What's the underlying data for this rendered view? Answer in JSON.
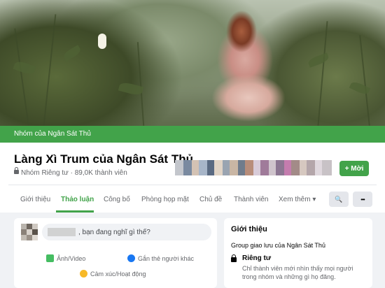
{
  "group_bar_label": "Nhóm của Ngân Sát Thủ",
  "group": {
    "title": "Làng Xì Trum của Ngân Sát Thủ",
    "privacy": "Nhóm Riêng tư",
    "members": "89,0K thành viên",
    "join_label": "+ Mời"
  },
  "tabs": [
    {
      "label": "Giới thiệu"
    },
    {
      "label": "Thảo luận"
    },
    {
      "label": "Công bố"
    },
    {
      "label": "Phòng họp mặt"
    },
    {
      "label": "Chủ đề"
    },
    {
      "label": "Thành viên"
    },
    {
      "label": "Xem thêm ▾"
    }
  ],
  "toolbar": {
    "search_glyph": "🔍",
    "more_glyph": "•••"
  },
  "composer": {
    "placeholder": ", bạn đang nghĩ gì thế?",
    "photo_video": "Ảnh/Video",
    "tag_people": "Gắn thẻ người khác",
    "feeling": "Cảm xúc/Hoạt động"
  },
  "about": {
    "heading": "Giới thiệu",
    "description": "Group giao lưu của Ngân Sát Thủ",
    "privacy_title": "Riêng tư",
    "privacy_desc": "Chỉ thành viên mới nhìn thấy mọi người trong nhóm và những gì họ đăng."
  },
  "colors": {
    "accent": "#42a34a",
    "background": "#f0f2f5"
  }
}
